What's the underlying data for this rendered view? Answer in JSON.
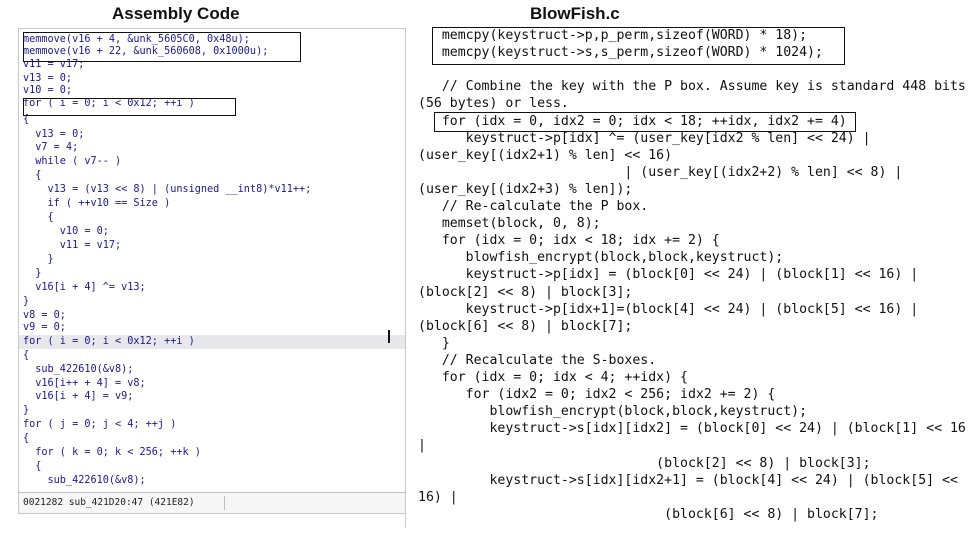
{
  "titles": {
    "assembly": "Assembly Code",
    "c": "BlowFish.c"
  },
  "assembly_lines": [
    "memmove(v16 + 4, &unk_5605C0, 0x48u);",
    "memmove(v16 + 22, &unk_560608, 0x1000u);",
    "v11 = v17;",
    "v13 = 0;",
    "v10 = 0;",
    "for ( i = 0; i < 0x12; ++i )",
    "{",
    "  v13 = 0;",
    "  v7 = 4;",
    "  while ( v7-- )",
    "  {",
    "    v13 = (v13 << 8) | (unsigned __int8)*v11++;",
    "    if ( ++v10 == Size )",
    "    {",
    "      v10 = 0;",
    "      v11 = v17;",
    "    }",
    "  }",
    "  v16[i + 4] ^= v13;",
    "}",
    "v8 = 0;",
    "v9 = 0;",
    "for ( i = 0; i < 0x12; ++i )",
    "{",
    "  sub_422610(&v8);",
    "  v16[i++ + 4] = v8;",
    "  v16[i + 4] = v9;",
    "}",
    "for ( j = 0; j < 4; ++j )",
    "{",
    "  for ( k = 0; k < 256; ++k )",
    "  {",
    "    sub_422610(&v8);"
  ],
  "assembly_status": "0021282 sub_421D20:47 (421E82)",
  "c_lines": [
    "   memcpy(keystruct->p,p_perm,sizeof(WORD) * 18);",
    "   memcpy(keystruct->s,s_perm,sizeof(WORD) * 1024);",
    "",
    "   // Combine the key with the P box. Assume key is standard 448 bits",
    "(56 bytes) or less.",
    "   for (idx = 0, idx2 = 0; idx < 18; ++idx, idx2 += 4)",
    "      keystruct->p[idx] ^= (user_key[idx2 % len] << 24) |",
    "(user_key[(idx2+1) % len] << 16)",
    "                          | (user_key[(idx2+2) % len] << 8) |",
    "(user_key[(idx2+3) % len]);",
    "   // Re-calculate the P box.",
    "   memset(block, 0, 8);",
    "   for (idx = 0; idx < 18; idx += 2) {",
    "      blowfish_encrypt(block,block,keystruct);",
    "      keystruct->p[idx] = (block[0] << 24) | (block[1] << 16) |",
    "(block[2] << 8) | block[3];",
    "      keystruct->p[idx+1]=(block[4] << 24) | (block[5] << 16) |",
    "(block[6] << 8) | block[7];",
    "   }",
    "   // Recalculate the S-boxes.",
    "   for (idx = 0; idx < 4; ++idx) {",
    "      for (idx2 = 0; idx2 < 256; idx2 += 2) {",
    "         blowfish_encrypt(block,block,keystruct);",
    "         keystruct->s[idx][idx2] = (block[0] << 24) | (block[1] << 16",
    "|",
    "                              (block[2] << 8) | block[3];",
    "         keystruct->s[idx][idx2+1] = (block[4] << 24) | (block[5] <<",
    "16) |",
    "                               (block[6] << 8) | block[7];"
  ]
}
